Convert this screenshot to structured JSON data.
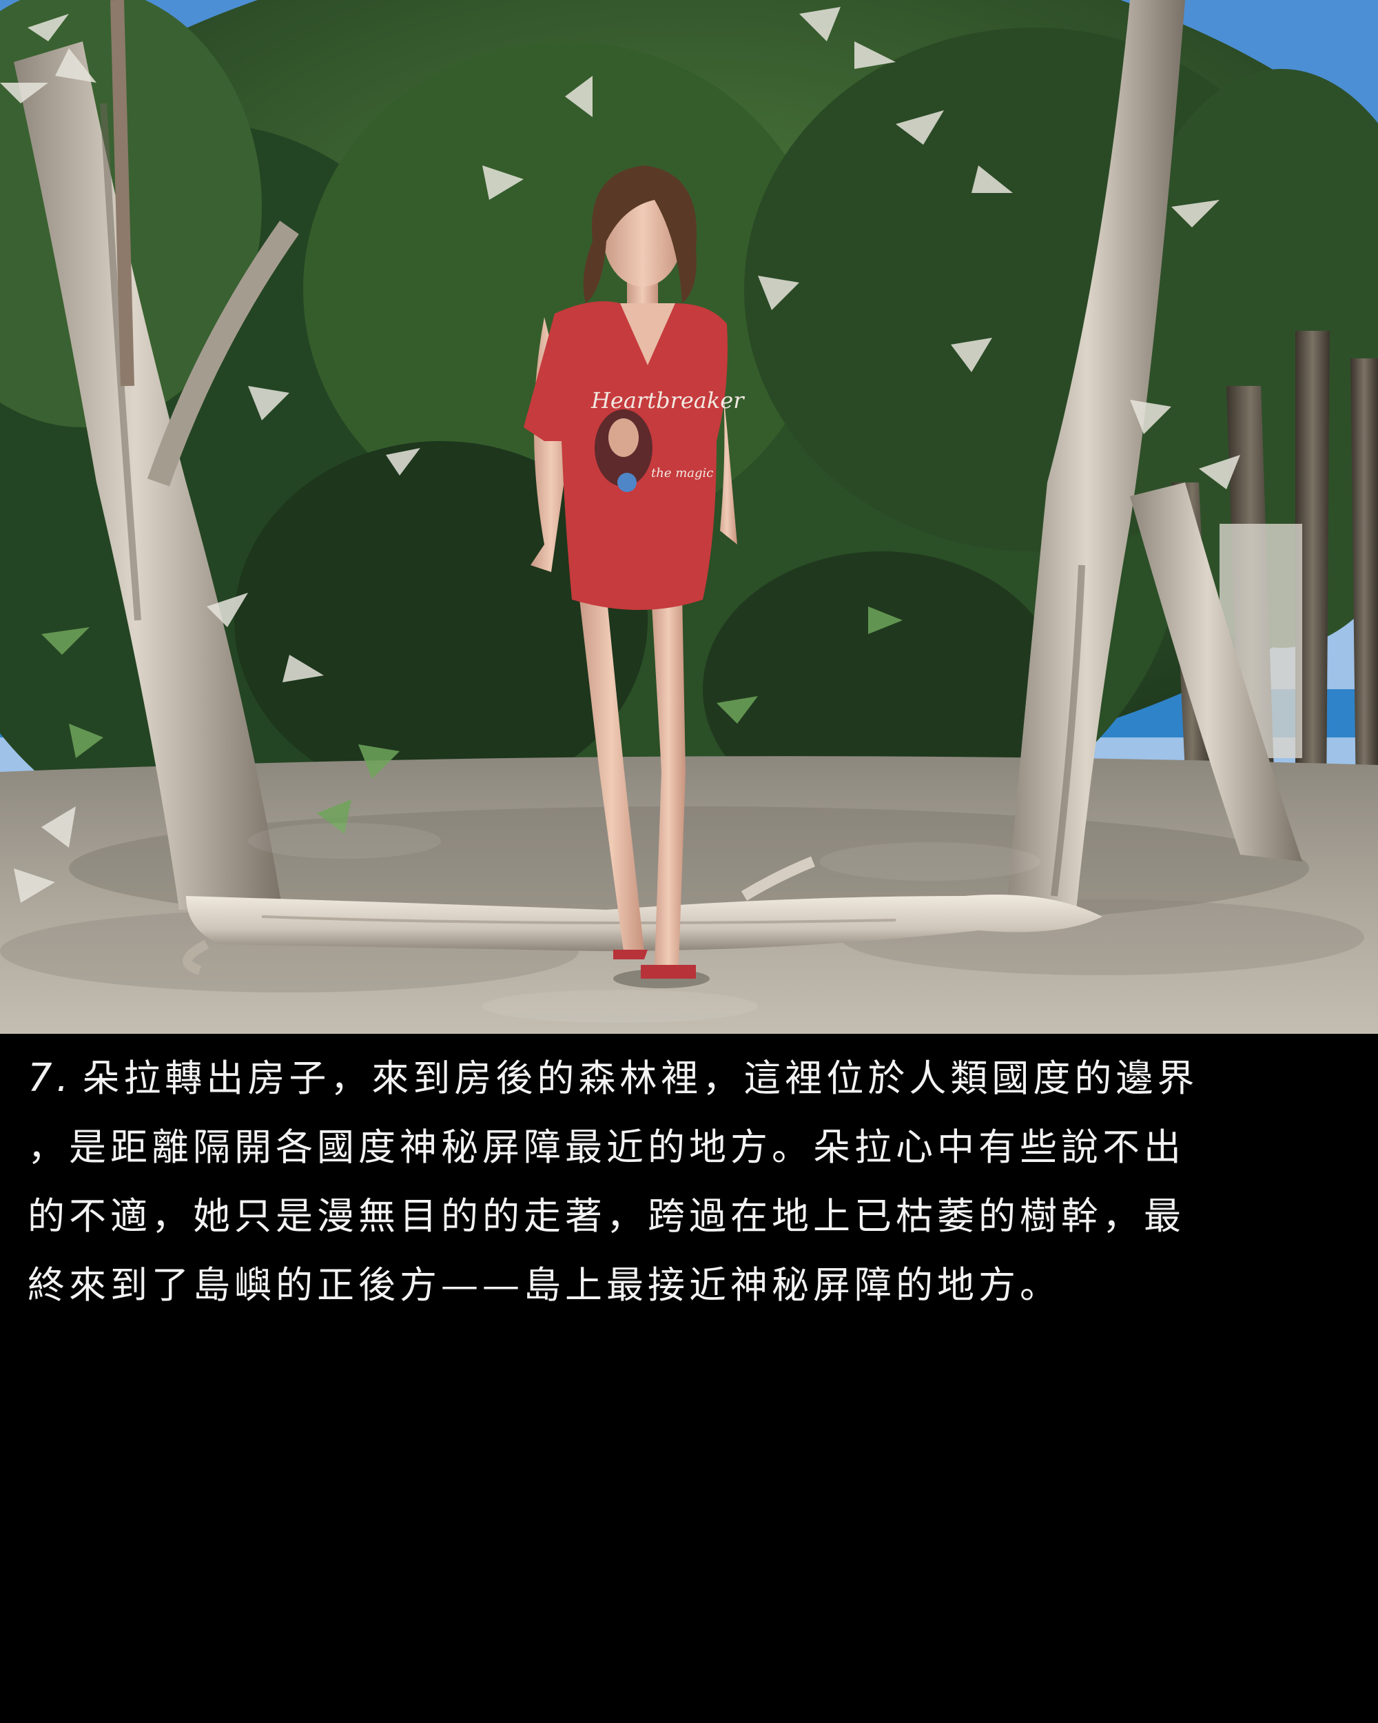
{
  "scene": {
    "shirt_print_text": "Heartbreaker",
    "shirt_print_subtext": "the magic",
    "colors": {
      "sky": "#4d8fd4",
      "sand": "#b8b2a6",
      "foliage_dark": "#1f3a1c",
      "foliage_mid": "#3f6a33",
      "leaf_light": "#e6e4dc",
      "bark": "#c9c0b4",
      "shirt": "#c63b3d",
      "hair": "#5a3a26",
      "skin": "#e3b7a0",
      "caption_bg": "#000000",
      "caption_text": "#f2f2f2"
    }
  },
  "caption": {
    "panel_number": "7.",
    "lines": [
      "朵拉轉出房子，來到房後的森林裡，這裡位於人類國度的邊界",
      "，是距離隔開各國度神秘屏障最近的地方。朵拉心中有些說不出",
      "的不適，她只是漫無目的的走著，跨過在地上已枯萎的樹幹，最",
      "終來到了島嶼的正後方——島上最接近神秘屏障的地方。"
    ]
  }
}
